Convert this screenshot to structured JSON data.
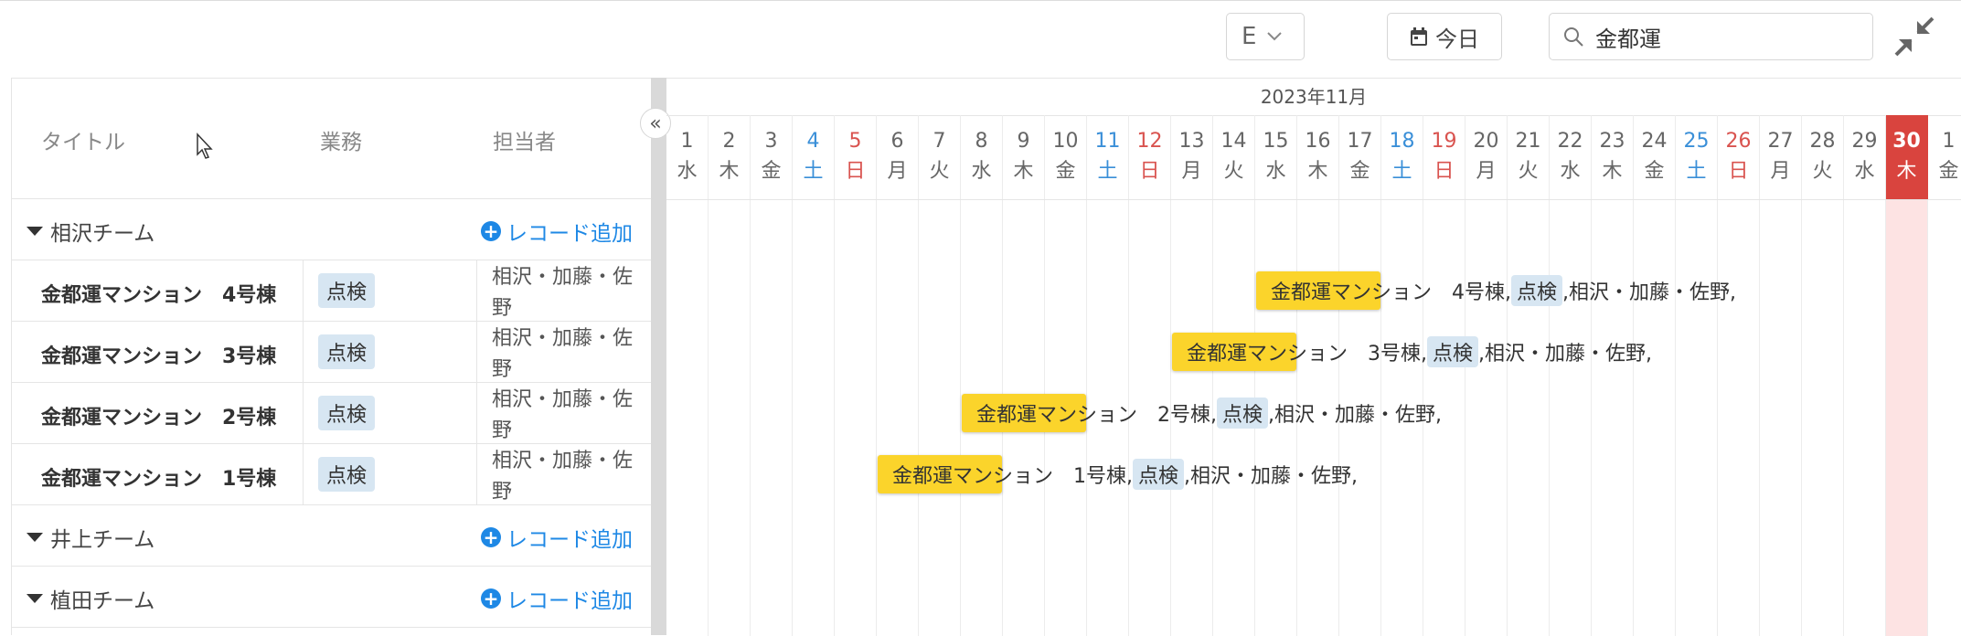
{
  "toolbar": {
    "view_mode": "E",
    "today_label": "今日",
    "search_value": "金都運"
  },
  "columns": {
    "title": "タイトル",
    "task": "業務",
    "assignee": "担当者"
  },
  "groups": [
    {
      "name": "相沢チーム",
      "add_label": "レコード追加"
    },
    {
      "name": "井上チーム",
      "add_label": "レコード追加"
    },
    {
      "name": "植田チーム",
      "add_label": "レコード追加"
    }
  ],
  "records": [
    {
      "title": "金都運マンション　4号棟",
      "task": "点検",
      "assignee": "相沢・加藤・佐野",
      "label_main": "金都運マンション　4号棟,",
      "label_tail": ",相沢・加藤・佐野,"
    },
    {
      "title": "金都運マンション　3号棟",
      "task": "点検",
      "assignee": "相沢・加藤・佐野",
      "label_main": "金都運マンション　3号棟,",
      "label_tail": ",相沢・加藤・佐野,"
    },
    {
      "title": "金都運マンション　2号棟",
      "task": "点検",
      "assignee": "相沢・加藤・佐野",
      "label_main": "金都運マンション　2号棟,",
      "label_tail": ",相沢・加藤・佐野,"
    },
    {
      "title": "金都運マンション　1号棟",
      "task": "点検",
      "assignee": "相沢・加藤・佐野",
      "label_main": "金都運マンション　1号棟,",
      "label_tail": ",相沢・加藤・佐野,"
    }
  ],
  "gantt": {
    "month": "2023年11月",
    "days": [
      {
        "n": "1",
        "w": "水"
      },
      {
        "n": "2",
        "w": "木"
      },
      {
        "n": "3",
        "w": "金"
      },
      {
        "n": "4",
        "w": "土"
      },
      {
        "n": "5",
        "w": "日"
      },
      {
        "n": "6",
        "w": "月"
      },
      {
        "n": "7",
        "w": "火"
      },
      {
        "n": "8",
        "w": "水"
      },
      {
        "n": "9",
        "w": "木"
      },
      {
        "n": "10",
        "w": "金"
      },
      {
        "n": "11",
        "w": "土"
      },
      {
        "n": "12",
        "w": "日"
      },
      {
        "n": "13",
        "w": "月"
      },
      {
        "n": "14",
        "w": "火"
      },
      {
        "n": "15",
        "w": "水"
      },
      {
        "n": "16",
        "w": "木"
      },
      {
        "n": "17",
        "w": "金"
      },
      {
        "n": "18",
        "w": "土"
      },
      {
        "n": "19",
        "w": "日"
      },
      {
        "n": "20",
        "w": "月"
      },
      {
        "n": "21",
        "w": "火"
      },
      {
        "n": "22",
        "w": "水"
      },
      {
        "n": "23",
        "w": "木"
      },
      {
        "n": "24",
        "w": "金"
      },
      {
        "n": "25",
        "w": "土"
      },
      {
        "n": "26",
        "w": "日"
      },
      {
        "n": "27",
        "w": "月"
      },
      {
        "n": "28",
        "w": "火"
      },
      {
        "n": "29",
        "w": "水"
      },
      {
        "n": "30",
        "w": "木"
      },
      {
        "n": "1",
        "w": "金"
      }
    ],
    "today": "30",
    "bar_start_days": [
      "15",
      "13",
      "8",
      "6"
    ],
    "colors": {
      "saturday": "#3a8fd8",
      "sunday": "#d9534f",
      "weekday": "#666666",
      "bar": "#fbd42b",
      "today": "#d9443e"
    }
  }
}
